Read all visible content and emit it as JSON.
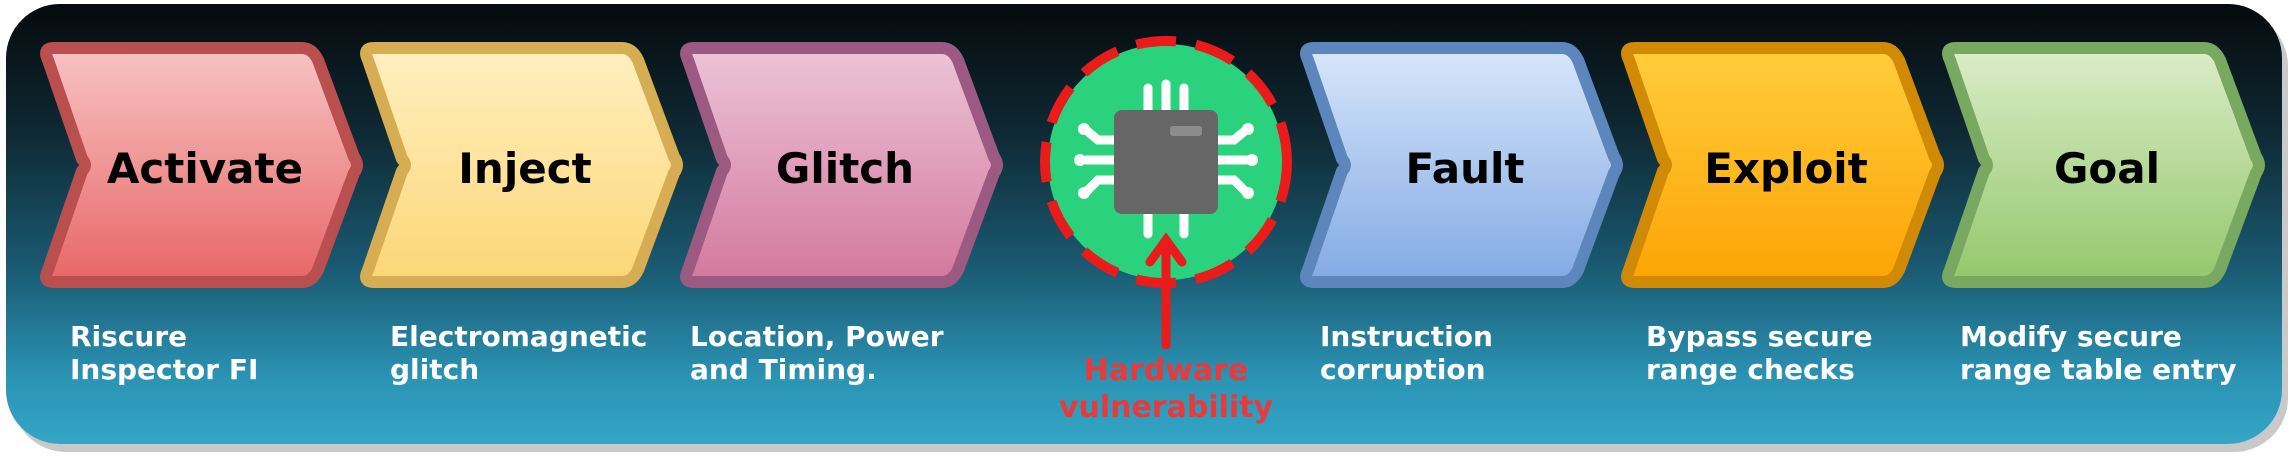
{
  "steps": [
    {
      "label": "Activate",
      "desc": [
        "Riscure",
        "Inspector FI"
      ],
      "color_light": "#f8c4c4",
      "color_dark": "#e86666",
      "border": "#b94f4f"
    },
    {
      "label": "Inject",
      "desc": [
        "Electromagnetic",
        "glitch"
      ],
      "color_light": "#fff0c0",
      "color_dark": "#fcd677",
      "border": "#d6ad52"
    },
    {
      "label": "Glitch",
      "desc": [
        "Location, Power",
        "and Timing."
      ],
      "color_light": "#ecc4d8",
      "color_dark": "#d4789e",
      "border": "#9c5a82"
    },
    {
      "label": "Fault",
      "desc": [
        "Instruction",
        "corruption"
      ],
      "color_light": "#d8e6fb",
      "color_dark": "#82aae4",
      "border": "#5d86bd"
    },
    {
      "label": "Exploit",
      "desc": [
        "Bypass secure",
        "range checks"
      ],
      "color_light": "#ffcd3c",
      "color_dark": "#fca405",
      "border": "#d08a06"
    },
    {
      "label": "Goal",
      "desc": [
        "Modify secure",
        "range table entry"
      ],
      "color_light": "#dcecc8",
      "color_dark": "#92c86c",
      "border": "#79a860"
    }
  ],
  "chip": {
    "icon": "microchip-icon",
    "label": [
      "Hardware",
      "vulnerability"
    ],
    "circle_color": "#2ad27e",
    "ring_color": "#ea1b1b",
    "body_color": "#666666"
  }
}
